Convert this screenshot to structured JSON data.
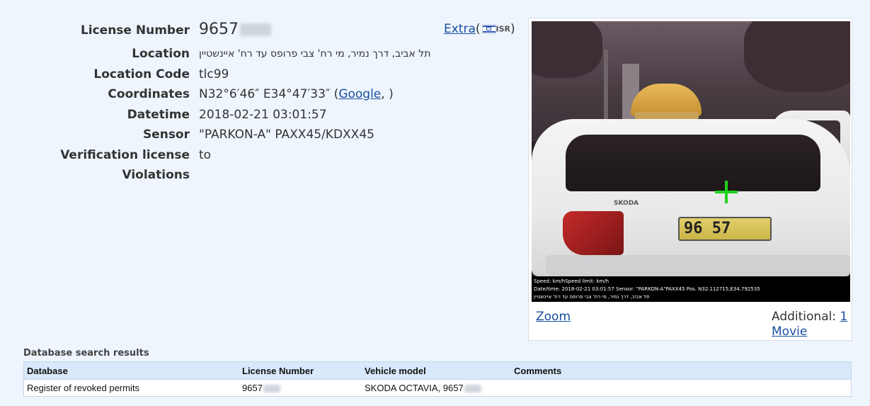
{
  "record": {
    "license_number_label": "License Number",
    "license_number_value": "9657",
    "location_label": "Location",
    "location_value": "תל אביב, דרך נמיר, מי רח' צבי פרופס עד רח' איינשטיין",
    "location_code_label": "Location Code",
    "location_code_value": "tlc99",
    "coordinates_label": "Coordinates",
    "coordinates_value": "N32°6′46″ E34°47′33″",
    "coordinates_open": "(",
    "coordinates_google": "Google",
    "coordinates_close": ", )",
    "datetime_label": "Datetime",
    "datetime_value": "2018-02-21 03:01:57",
    "sensor_label": "Sensor",
    "sensor_value": "\"PARKON-A\" PAXX45/KDXX45",
    "verification_label": "Verification license",
    "verification_value": "to",
    "violations_label": "Violations"
  },
  "extra": {
    "link": "Extra",
    "paren_open": "(",
    "country_code": "ISR",
    "paren_close": ")",
    "flag_icon": "israel-flag-icon"
  },
  "photo": {
    "plate_text": "96 57",
    "badge_text": "SKODA",
    "caption_line1": "Speed:  km/hSpeed limit:  km/h",
    "caption_line2": "Date/time:  2018-02-21 03:01:57   Sensor: \"PARKON-A\"PAXX45   Pos.  N32.112715,E34.792535",
    "caption_line3": "תל אביב, דרך נמיר, מי רח' צבי פרופס עד רח' איינשטיין",
    "zoom_link": "Zoom",
    "additional_label": "Additional:",
    "additional_count": "1",
    "movie_link": "Movie"
  },
  "db": {
    "title": "Database search results",
    "columns": [
      "Database",
      "License Number",
      "Vehicle model",
      "Comments"
    ],
    "rows": [
      {
        "database": "Register of revoked permits",
        "license_number": "9657",
        "vehicle_model": "SKODA OCTAVIA, 9657",
        "comments": ""
      }
    ]
  },
  "colors": {
    "page_bg": "#eef5fd",
    "link": "#1a4fa0",
    "table_header_bg": "#d9e8fa",
    "crosshair": "#22d11d"
  }
}
